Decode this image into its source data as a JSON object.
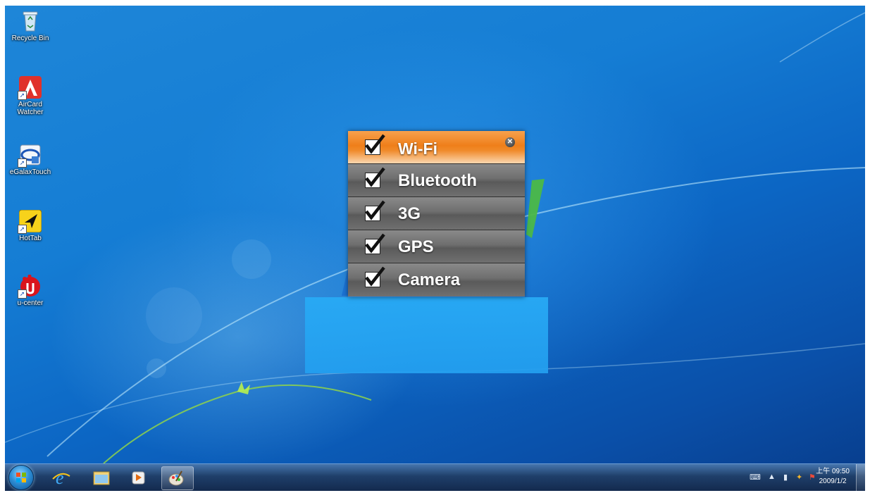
{
  "desktop_icons": [
    {
      "label": "Recycle Bin",
      "icon": "recycle-bin-icon"
    },
    {
      "label": "AirCard Watcher",
      "icon": "aircard-watcher-icon"
    },
    {
      "label": "eGalaxTouch",
      "icon": "egalaxtouch-icon"
    },
    {
      "label": "HotTab",
      "icon": "hottab-icon"
    },
    {
      "label": "u-center",
      "icon": "u-center-icon"
    }
  ],
  "wireless_panel": {
    "items": [
      {
        "label": "Wi-Fi",
        "checked": true
      },
      {
        "label": "Bluetooth",
        "checked": true
      },
      {
        "label": "3G",
        "checked": true
      },
      {
        "label": "GPS",
        "checked": true
      },
      {
        "label": "Camera",
        "checked": true
      }
    ],
    "close_icon": "close-icon",
    "header_color": "#ef7f1a",
    "row_color": "#6e6e6e"
  },
  "taskbar": {
    "pinned": [
      "internet-explorer-icon",
      "windows-explorer-icon",
      "media-player-icon",
      "paint-icon"
    ],
    "clock_time": "上午 09:50",
    "clock_date": "2009/1/2"
  }
}
